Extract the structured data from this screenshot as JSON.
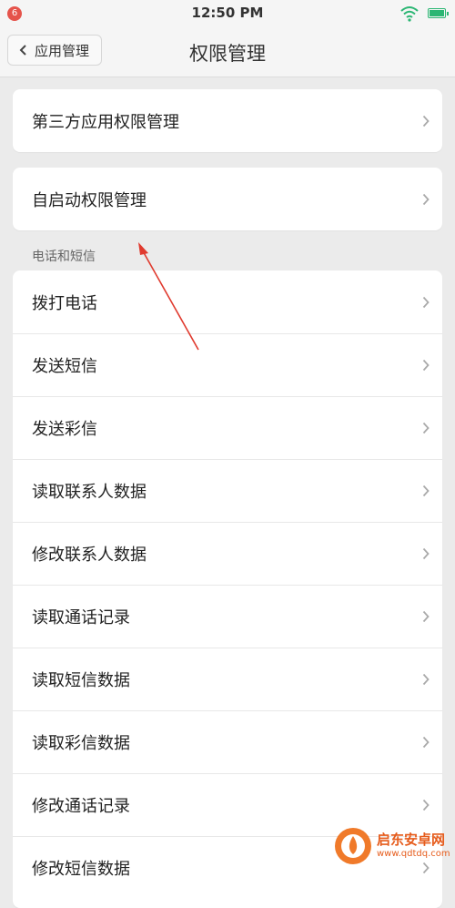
{
  "status_bar": {
    "notification_count": "6",
    "time": "12:50 PM"
  },
  "header": {
    "back_label": "应用管理",
    "title": "权限管理"
  },
  "top_items": [
    {
      "label": "第三方应用权限管理"
    },
    {
      "label": "自启动权限管理"
    }
  ],
  "section": {
    "title": "电话和短信",
    "items": [
      {
        "label": "拨打电话"
      },
      {
        "label": "发送短信"
      },
      {
        "label": "发送彩信"
      },
      {
        "label": "读取联系人数据"
      },
      {
        "label": "修改联系人数据"
      },
      {
        "label": "读取通话记录"
      },
      {
        "label": "读取短信数据"
      },
      {
        "label": "读取彩信数据"
      },
      {
        "label": "修改通话记录"
      },
      {
        "label": "修改短信数据"
      }
    ]
  },
  "watermark": {
    "name": "启东安卓网",
    "url": "www.qdtdq.com"
  },
  "colors": {
    "annotation_arrow": "#e03a2e",
    "battery": "#2bb673",
    "wifi": "#2bb673",
    "badge": "#e5534b"
  }
}
